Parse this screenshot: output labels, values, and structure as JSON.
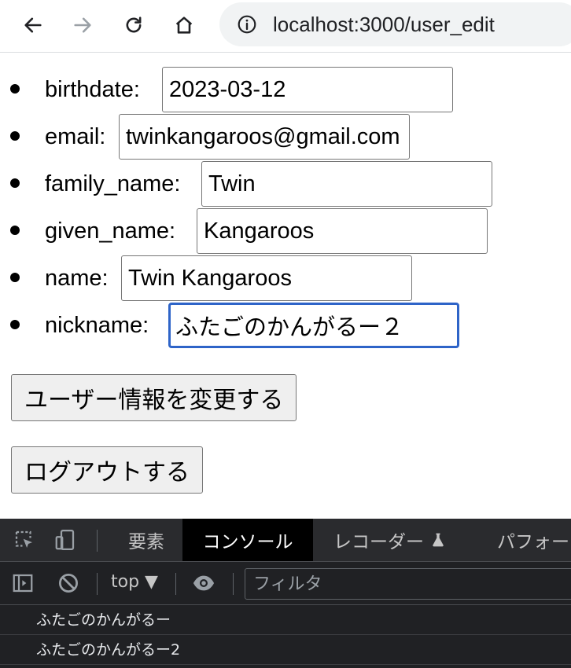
{
  "browser": {
    "url": "localhost:3000/user_edit"
  },
  "form": {
    "fields": [
      {
        "label": "birthdate:",
        "value": "2023-03-12"
      },
      {
        "label": "email:",
        "value": "twinkangaroos@gmail.com"
      },
      {
        "label": "family_name:",
        "value": "Twin"
      },
      {
        "label": "given_name:",
        "value": "Kangaroos"
      },
      {
        "label": "name:",
        "value": "Twin Kangaroos"
      },
      {
        "label": "nickname:",
        "value": "ふたごのかんがるー２"
      }
    ],
    "update_button": "ユーザー情報を変更する",
    "logout_button": "ログアウトする"
  },
  "devtools": {
    "tabs": [
      "要素",
      "コンソール",
      "レコーダー",
      "パフォーマンス"
    ],
    "active_tab": "コンソール",
    "context": "top ▼",
    "filter_placeholder": "フィルタ",
    "logs": [
      "ふたごのかんがるー",
      "ふたごのかんがるー2"
    ]
  }
}
